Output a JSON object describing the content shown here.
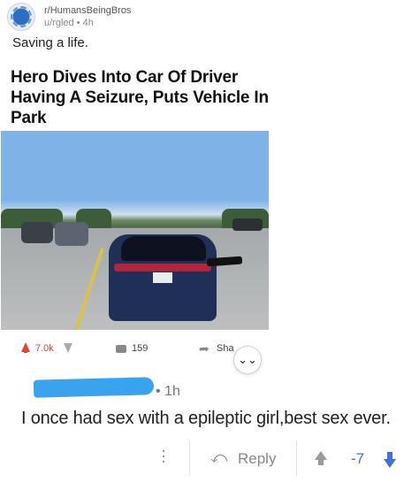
{
  "post": {
    "subreddit": "r/HumansBeingBros",
    "author": "u/rgled",
    "age": "4h",
    "meta_separator": "•",
    "title": "Saving a life.",
    "article": {
      "headline": "Hero Dives Into Car Of Driver Having A Seizure, Puts Vehicle In Park"
    },
    "actions": {
      "votes": "7.0k",
      "comments": "159",
      "share_label": "Sha"
    },
    "colors": {
      "upvote_accent": "#e8412f"
    }
  },
  "comment": {
    "author_redacted": true,
    "age": "• 1h",
    "body": "I once had sex with a epileptic girl,best sex ever.",
    "actions": {
      "reply_label": "Reply",
      "score": "-7"
    },
    "colors": {
      "downvote_accent": "#3f6fd8",
      "redaction": "#3aa3ef"
    }
  },
  "icons": {
    "subreddit_avatar": "subreddit-avatar-icon",
    "upvote": "upvote-arrow-icon",
    "downvote": "downvote-arrow-icon",
    "comment": "comment-bubble-icon",
    "share": "share-arrow-icon",
    "expand": "chevron-double-down-icon",
    "more": "vertical-ellipsis-icon",
    "reply": "reply-arrow-icon"
  }
}
